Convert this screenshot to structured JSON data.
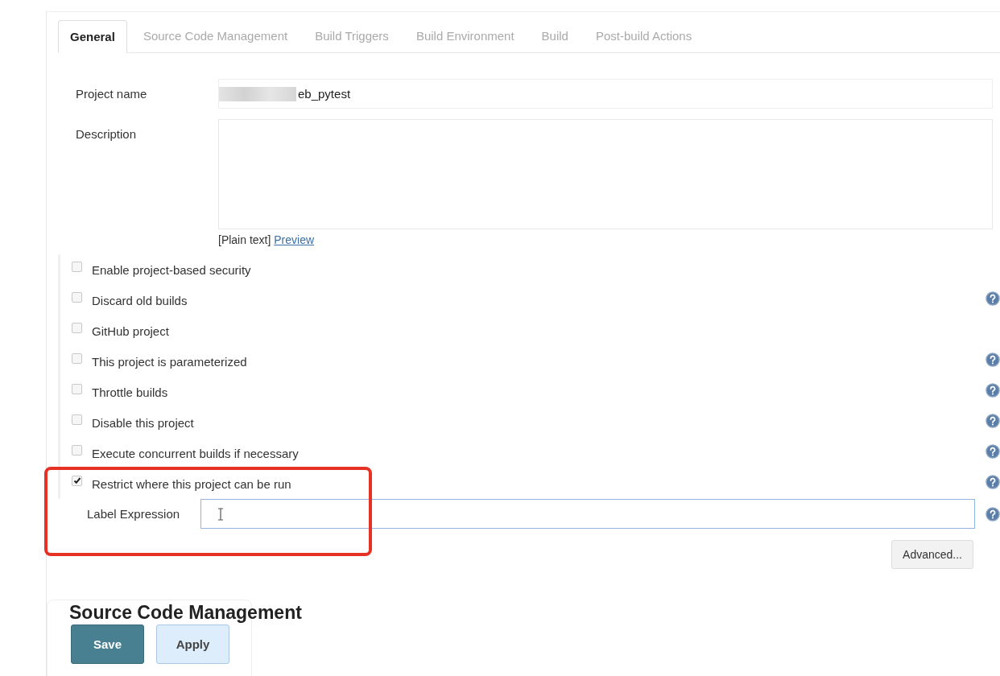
{
  "tabs": [
    {
      "label": "General",
      "selected": true
    },
    {
      "label": "Source Code Management",
      "selected": false
    },
    {
      "label": "Build Triggers",
      "selected": false
    },
    {
      "label": "Build Environment",
      "selected": false
    },
    {
      "label": "Build",
      "selected": false
    },
    {
      "label": "Post-build Actions",
      "selected": false
    }
  ],
  "project_name": {
    "label": "Project name",
    "value": "eb_pytest",
    "redacted": true
  },
  "description": {
    "label": "Description"
  },
  "format_note": "[Plain text]",
  "preview_link": "Preview",
  "options": [
    {
      "label": "Enable project-based security",
      "checked": false,
      "help": false
    },
    {
      "label": "Discard old builds",
      "checked": false,
      "help": true
    },
    {
      "label": "GitHub project",
      "checked": false,
      "help": false
    },
    {
      "label": "This project is parameterized",
      "checked": false,
      "help": true
    },
    {
      "label": "Throttle builds",
      "checked": false,
      "help": true
    },
    {
      "label": "Disable this project",
      "checked": false,
      "help": true
    },
    {
      "label": "Execute concurrent builds if necessary",
      "checked": false,
      "help": true
    },
    {
      "label": "Restrict where this project can be run",
      "checked": true,
      "help": true
    }
  ],
  "label_expression": {
    "label": "Label Expression",
    "focused": true
  },
  "advanced_button": "Advanced...",
  "section_heading": "Source Code Management",
  "buttons": [
    {
      "label": "Save",
      "kind": "primary"
    },
    {
      "label": "Apply",
      "kind": "secondary"
    }
  ]
}
